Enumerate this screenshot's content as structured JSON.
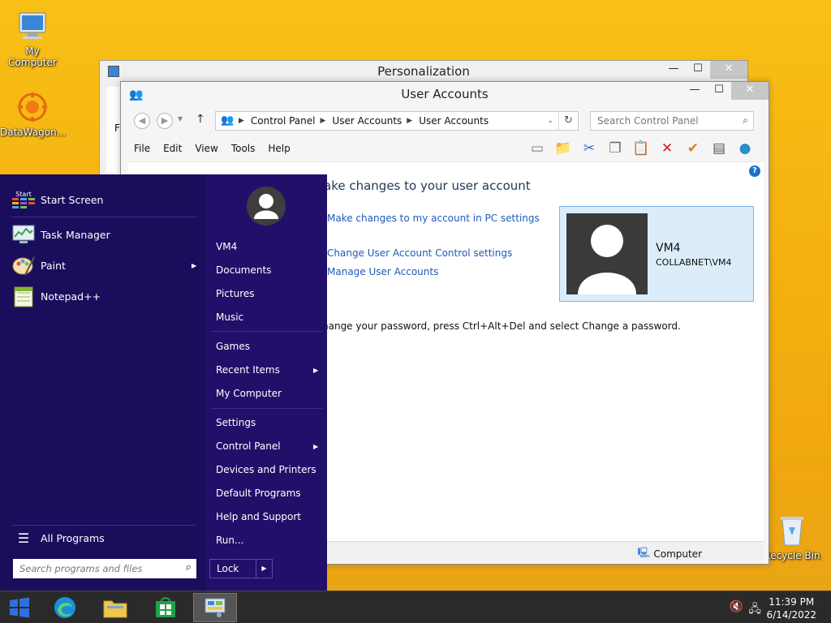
{
  "desktop": {
    "icons": [
      {
        "label": "My Computer"
      },
      {
        "label": "DataWagon..."
      },
      {
        "label": "Recycle Bin"
      }
    ]
  },
  "personalization_window": {
    "title": "Personalization",
    "side_text": "Fi"
  },
  "user_accounts_window": {
    "title": "User Accounts",
    "breadcrumbs": [
      "Control Panel",
      "User Accounts",
      "User Accounts"
    ],
    "search_placeholder": "Search Control Panel",
    "menu": [
      "File",
      "Edit",
      "View",
      "Tools",
      "Help"
    ],
    "heading": "ake changes to your user account",
    "links": {
      "pc_settings": "Make changes to my account in PC settings",
      "uac_settings": "Change User Account Control settings",
      "manage_accounts": "Manage User Accounts"
    },
    "password_note": "hange your password, press Ctrl+Alt+Del and select Change a password.",
    "user": {
      "name": "VM4",
      "domain": "COLLABNET\\VM4"
    },
    "status": "Computer"
  },
  "start_menu": {
    "left_items": {
      "start_screen": "Start Screen",
      "start_label": "Start",
      "task_manager": "Task Manager",
      "paint": "Paint",
      "notepad": "Notepad++",
      "all_programs": "All Programs"
    },
    "search_placeholder": "Search programs and files",
    "right_items": {
      "user": "VM4",
      "documents": "Documents",
      "pictures": "Pictures",
      "music": "Music",
      "games": "Games",
      "recent_items": "Recent Items",
      "my_computer": "My Computer",
      "settings": "Settings",
      "control_panel": "Control Panel",
      "devices_printers": "Devices and Printers",
      "default_programs": "Default Programs",
      "help_support": "Help and Support",
      "run": "Run..."
    },
    "lock_label": "Lock"
  },
  "taskbar": {
    "time": "11:39 PM",
    "date": "6/14/2022"
  }
}
